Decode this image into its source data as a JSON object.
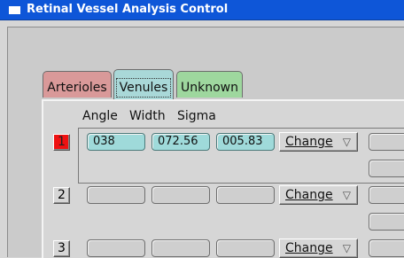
{
  "window": {
    "title": "Retinal Vessel Analysis Control"
  },
  "tabs": [
    {
      "label": "Arterioles",
      "color": "#d99999"
    },
    {
      "label": "Venules",
      "color": "#a9d8d8",
      "selected": true
    },
    {
      "label": "Unknown",
      "color": "#9ed79e"
    }
  ],
  "columns": {
    "angle": "Angle",
    "width": "Width",
    "sigma": "Sigma"
  },
  "rows": [
    {
      "number": "1",
      "active": true,
      "angle": "038",
      "width": "072.56",
      "sigma": "005.83",
      "button": "Change"
    },
    {
      "number": "2",
      "active": false,
      "angle": "",
      "width": "",
      "sigma": "",
      "button": "Change"
    },
    {
      "number": "3",
      "active": false,
      "angle": "",
      "width": "",
      "sigma": "",
      "button": "Change"
    }
  ],
  "colors": {
    "titlebar": "#0e56d8",
    "active_row": "#ee1111",
    "filled_field": "#9fdada"
  },
  "icons": {
    "dropdown": "triangle-down-icon"
  }
}
